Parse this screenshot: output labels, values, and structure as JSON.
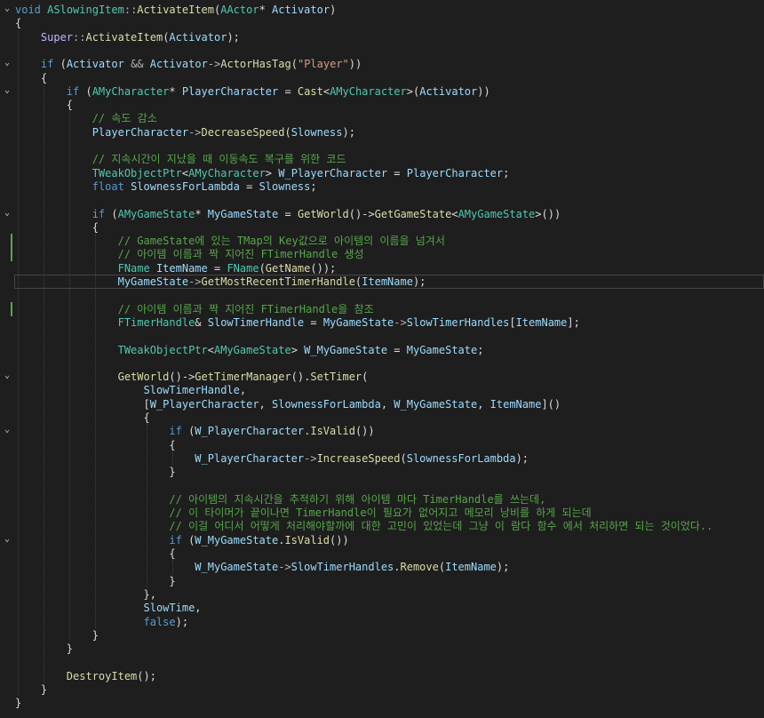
{
  "code": {
    "language": "C++",
    "lines": [
      "void ASlowingItem::ActivateItem(AActor* Activator)",
      "{",
      "    Super::ActivateItem(Activator);",
      "",
      "    if (Activator && Activator->ActorHasTag(\"Player\"))",
      "    {",
      "        if (AMyCharacter* PlayerCharacter = Cast<AMyCharacter>(Activator))",
      "        {",
      "            // 속도 감소",
      "            PlayerCharacter->DecreaseSpeed(Slowness);",
      "",
      "            // 지속시간이 지났을 때 이동속도 복구를 위한 코드",
      "            TWeakObjectPtr<AMyCharacter> W_PlayerCharacter = PlayerCharacter;",
      "            float SlownessForLambda = Slowness;",
      "",
      "            if (AMyGameState* MyGameState = GetWorld()->GetGameState<AMyGameState>())",
      "            {",
      "                // GameState에 있는 TMap의 Key값으로 아이템의 이름을 넘겨서",
      "                // 아이템 이름과 짝 지어진 FTimerHandle 생성",
      "                FName ItemName = FName(GetName());",
      "                MyGameState->GetMostRecentTimerHandle(ItemName);",
      "",
      "                // 아이템 이름과 짝 지어진 FTimerHandle을 참조",
      "                FTimerHandle& SlowTimerHandle = MyGameState->SlowTimerHandles[ItemName];",
      "",
      "                TWeakObjectPtr<AMyGameState> W_MyGameState = MyGameState;",
      "",
      "                GetWorld()->GetTimerManager().SetTimer(",
      "                    SlowTimerHandle,",
      "                    [W_PlayerCharacter, SlownessForLambda, W_MyGameState, ItemName]()",
      "                    {",
      "                        if (W_PlayerCharacter.IsValid())",
      "                        {",
      "                            W_PlayerCharacter->IncreaseSpeed(SlownessForLambda);",
      "                        }",
      "",
      "                        // 아이템의 지속시간을 추적하기 위해 아이템 마다 TimerHandle를 쓰는데,",
      "                        // 이 타이머가 끝이나면 TimerHandle이 필요가 없어지고 메모리 낭비를 하게 되는데",
      "                        // 이걸 어디서 어떻게 처리해야할까에 대한 고민이 있었는데 그냥 이 람다 함수 에서 처리하면 되는 것이었다..",
      "                        if (W_MyGameState.IsValid())",
      "                        {",
      "                            W_MyGameState->SlowTimerHandles.Remove(ItemName);",
      "                        }",
      "                    },",
      "                    SlowTime,",
      "                    false);",
      "            }",
      "        }",
      "",
      "        DestroyItem();",
      "    }",
      "}"
    ]
  },
  "colors": {
    "background": "#1e1e1e",
    "keyword": "#569cd6",
    "type": "#4ec9b0",
    "function": "#dcdcaa",
    "parameter": "#9cdcfe",
    "string": "#d69d85",
    "comment": "#57a64a",
    "plain": "#dcdcdc"
  }
}
